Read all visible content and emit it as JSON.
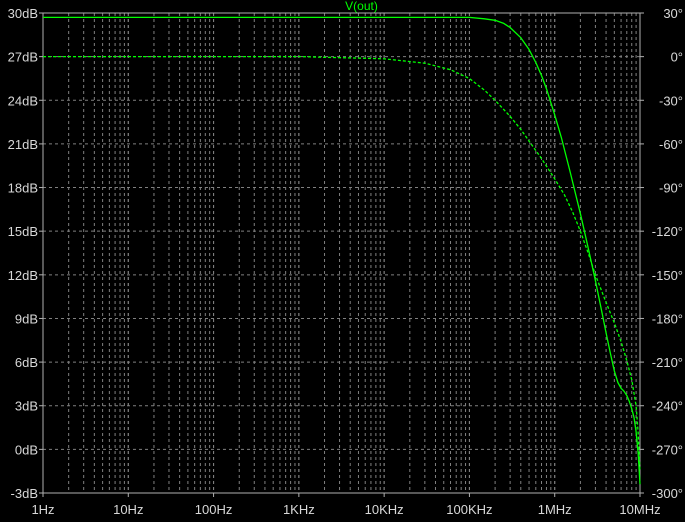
{
  "chart_data": {
    "type": "line",
    "title": "V(out)",
    "x_scale": "log",
    "xlim_hz": [
      1,
      10000000
    ],
    "x_ticks": [
      {
        "value": 1,
        "label": "1Hz"
      },
      {
        "value": 10,
        "label": "10Hz"
      },
      {
        "value": 100,
        "label": "100Hz"
      },
      {
        "value": 1000,
        "label": "1KHz"
      },
      {
        "value": 10000,
        "label": "10KHz"
      },
      {
        "value": 100000,
        "label": "100KHz"
      },
      {
        "value": 1000000,
        "label": "1MHz"
      },
      {
        "value": 10000000,
        "label": "10MHz"
      }
    ],
    "ylim_db": [
      -3,
      30
    ],
    "y_ticks_left": [
      {
        "value": 30,
        "label": "30dB"
      },
      {
        "value": 27,
        "label": "27dB"
      },
      {
        "value": 24,
        "label": "24dB"
      },
      {
        "value": 21,
        "label": "21dB"
      },
      {
        "value": 18,
        "label": "18dB"
      },
      {
        "value": 15,
        "label": "15dB"
      },
      {
        "value": 12,
        "label": "12dB"
      },
      {
        "value": 9,
        "label": "9dB"
      },
      {
        "value": 6,
        "label": "6dB"
      },
      {
        "value": 3,
        "label": "3dB"
      },
      {
        "value": 0,
        "label": "0dB"
      },
      {
        "value": -3,
        "label": "-3dB"
      }
    ],
    "ylim_deg": [
      -300,
      30
    ],
    "y_ticks_right": [
      {
        "value": 30,
        "label": "30°"
      },
      {
        "value": 0,
        "label": "0°"
      },
      {
        "value": -30,
        "label": "-30°"
      },
      {
        "value": -60,
        "label": "-60°"
      },
      {
        "value": -90,
        "label": "-90°"
      },
      {
        "value": -120,
        "label": "-120°"
      },
      {
        "value": -150,
        "label": "-150°"
      },
      {
        "value": -180,
        "label": "-180°"
      },
      {
        "value": -210,
        "label": "-210°"
      },
      {
        "value": -240,
        "label": "-240°"
      },
      {
        "value": -270,
        "label": "-270°"
      },
      {
        "value": -300,
        "label": "-300°"
      }
    ],
    "grid": true,
    "series": [
      {
        "axis": "left",
        "style": "solid",
        "color": "#00ff00",
        "points": [
          [
            1,
            29.7
          ],
          [
            100000,
            29.7
          ],
          [
            150000,
            29.6
          ],
          [
            200000,
            29.5
          ],
          [
            250000,
            29.3
          ],
          [
            300000,
            29.0
          ],
          [
            400000,
            28.3
          ],
          [
            500000,
            27.5
          ],
          [
            600000,
            26.6
          ],
          [
            700000,
            25.7
          ],
          [
            800000,
            24.8
          ],
          [
            1000000,
            23.0
          ],
          [
            1200000,
            21.4
          ],
          [
            1500000,
            19.2
          ],
          [
            2000000,
            16.2
          ],
          [
            2500000,
            13.7
          ],
          [
            3000000,
            11.6
          ],
          [
            3500000,
            9.7
          ],
          [
            4000000,
            8.0
          ],
          [
            4500000,
            6.6
          ],
          [
            5000000,
            5.4
          ],
          [
            5500000,
            4.6
          ],
          [
            6000000,
            4.2
          ],
          [
            6500000,
            4.0
          ],
          [
            7000000,
            3.7
          ],
          [
            7500000,
            3.3
          ],
          [
            8000000,
            2.8
          ],
          [
            8500000,
            2.2
          ],
          [
            9000000,
            1.2
          ],
          [
            9500000,
            -0.2
          ],
          [
            10000000,
            -2.4
          ]
        ]
      },
      {
        "axis": "right",
        "style": "dashed",
        "color": "#00ff00",
        "points": [
          [
            1,
            0
          ],
          [
            1000,
            0
          ],
          [
            10000,
            -1.5
          ],
          [
            30000,
            -4.5
          ],
          [
            60000,
            -9
          ],
          [
            100000,
            -15
          ],
          [
            150000,
            -23
          ],
          [
            200000,
            -30
          ],
          [
            300000,
            -41
          ],
          [
            400000,
            -50
          ],
          [
            500000,
            -58
          ],
          [
            700000,
            -70
          ],
          [
            1000000,
            -84
          ],
          [
            1300000,
            -95
          ],
          [
            1600000,
            -106
          ],
          [
            2000000,
            -120
          ],
          [
            2500000,
            -136
          ],
          [
            3000000,
            -150
          ],
          [
            4000000,
            -169
          ],
          [
            5000000,
            -183
          ],
          [
            6000000,
            -196
          ],
          [
            7000000,
            -209
          ],
          [
            8000000,
            -222
          ],
          [
            9000000,
            -240
          ],
          [
            9500000,
            -258
          ],
          [
            10000000,
            -285
          ]
        ]
      }
    ]
  }
}
